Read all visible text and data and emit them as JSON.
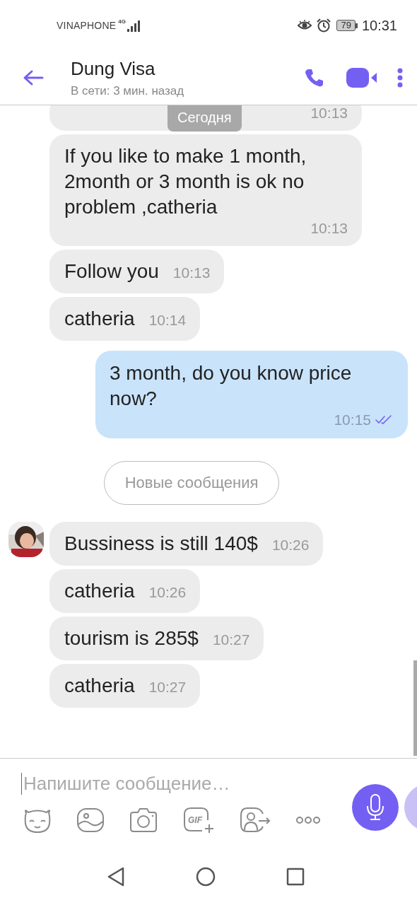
{
  "status_bar": {
    "carrier": "VINAPHONE",
    "network": "4G",
    "battery": "79",
    "time": "10:31"
  },
  "header": {
    "title": "Dung Visa",
    "subtitle": "В сети: 3 мин. назад"
  },
  "date_label": "Сегодня",
  "messages": [
    {
      "kind": "incoming",
      "time": "10:13"
    },
    {
      "kind": "incoming",
      "text": "If you like to make 1 month, 2month or 3 month is ok no problem ,catheria",
      "time": "10:13"
    },
    {
      "kind": "incoming",
      "text": "Follow you",
      "time": "10:13"
    },
    {
      "kind": "incoming",
      "text": "catheria",
      "time": "10:14"
    },
    {
      "kind": "outgoing",
      "text": "3 month, do you know price now?",
      "time": "10:15",
      "read": true
    },
    {
      "kind": "divider",
      "text": "Новые сообщения"
    },
    {
      "kind": "incoming",
      "avatar": true,
      "text": "Bussiness is still 140$",
      "time": "10:26"
    },
    {
      "kind": "incoming",
      "text": "catheria",
      "time": "10:26"
    },
    {
      "kind": "incoming",
      "text": "tourism is 285$",
      "time": "10:27"
    },
    {
      "kind": "incoming",
      "text": "catheria",
      "time": "10:27"
    }
  ],
  "composer": {
    "placeholder": "Напишите сообщение…",
    "gif_label": "GIF"
  }
}
